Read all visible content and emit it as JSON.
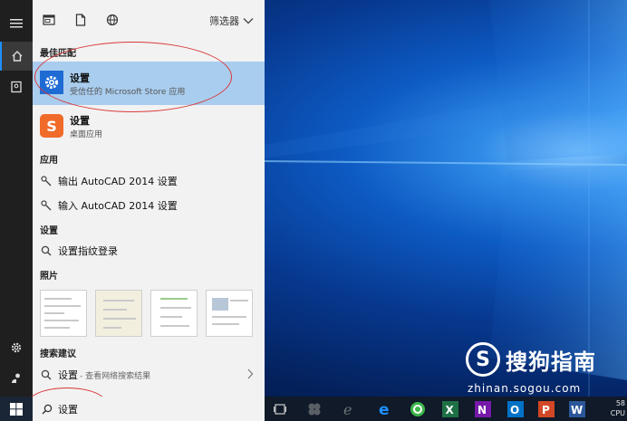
{
  "panel": {
    "filter_label": "筛选器",
    "sections": {
      "best_match": "最佳匹配",
      "apps": "应用",
      "settings": "设置",
      "photos": "照片",
      "search_suggestions": "搜索建议"
    },
    "best_match": {
      "title": "设置",
      "subtitle": "受信任的 Microsoft Store 应用"
    },
    "second_result": {
      "title": "设置",
      "subtitle": "桌面应用"
    },
    "apps": [
      {
        "label": "输出 AutoCAD 2014 设置"
      },
      {
        "label": "输入 AutoCAD 2014 设置"
      }
    ],
    "settings": [
      {
        "label": "设置指纹登录"
      }
    ],
    "suggestion": {
      "label": "设置",
      "sub": "- 查看网络搜索结果"
    }
  },
  "taskbar": {
    "search_value": "设置",
    "tray_line1": "58",
    "tray_line2": "CPU"
  },
  "watermark": {
    "logo_text": "S",
    "title": "搜狗指南",
    "url": "zhinan.sogou.com"
  },
  "colors": {
    "accent": "#1f6bd4",
    "selection": "#a9cdee",
    "annotation": "#d83a3a"
  }
}
